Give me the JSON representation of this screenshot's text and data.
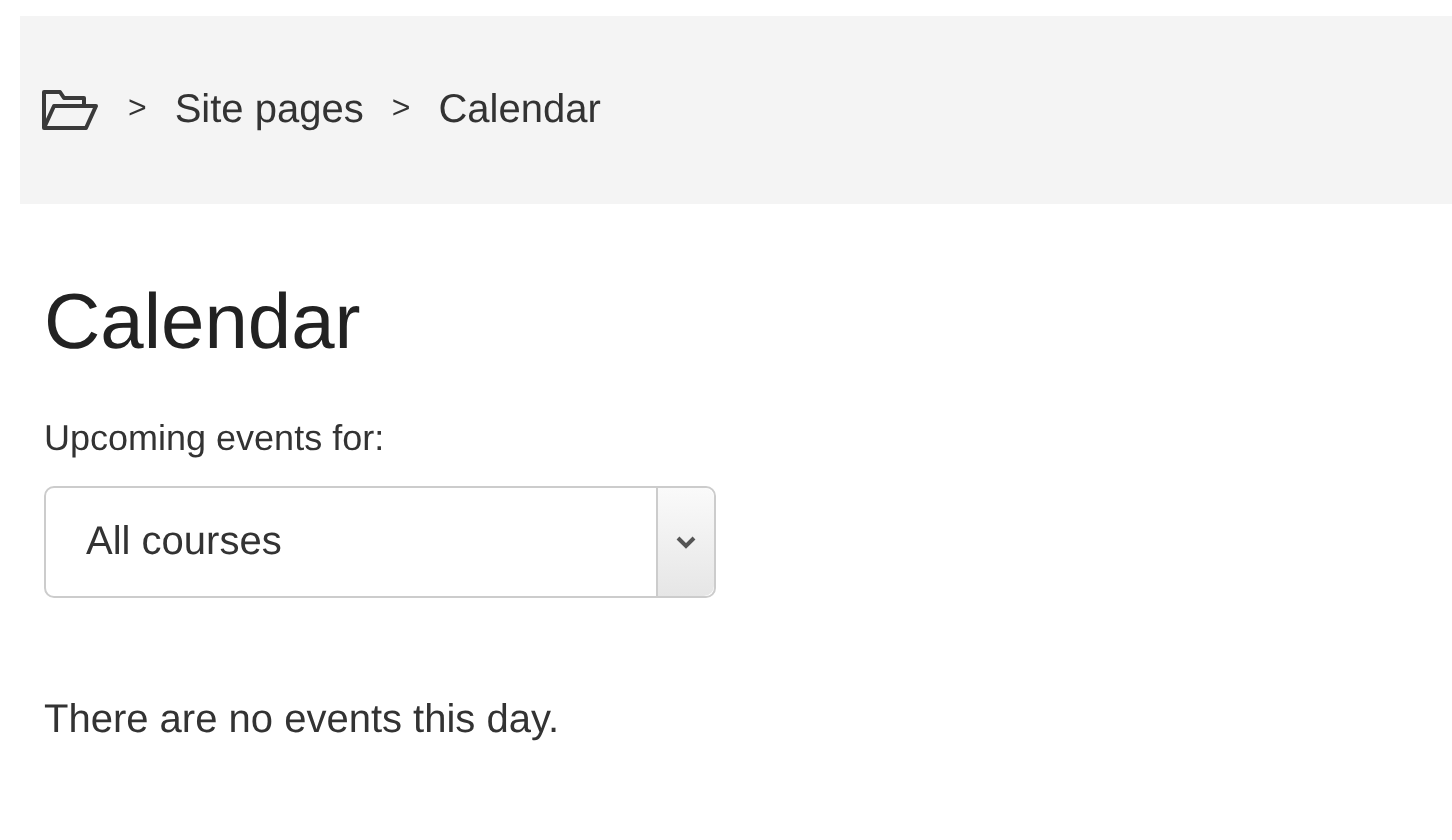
{
  "breadcrumb": [
    {
      "separator": ">",
      "label": "Site pages"
    },
    {
      "separator": ">",
      "label": "Calendar"
    }
  ],
  "heading": "Calendar",
  "filter": {
    "label": "Upcoming events for:",
    "value": "All courses"
  },
  "message": "There are no events this day."
}
